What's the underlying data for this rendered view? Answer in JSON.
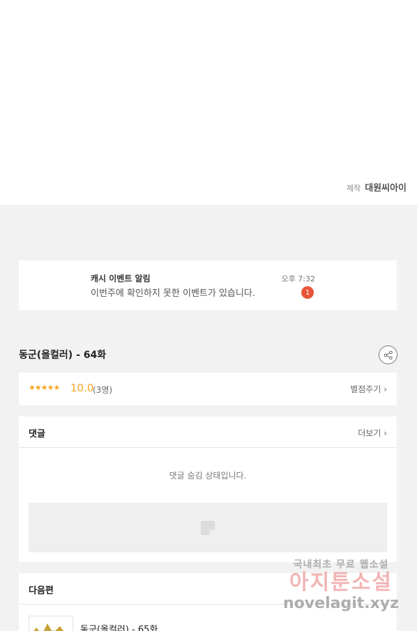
{
  "credit": {
    "label": "제작",
    "name": "대원씨아이"
  },
  "notice": {
    "title": "캐시 이벤트 알림",
    "message": "이번주에 확인하지 못한 이벤트가 있습니다.",
    "time": "오후 7:32",
    "badge": "1"
  },
  "episode": {
    "title": "동군(올컬러) - 64화"
  },
  "rating": {
    "stars": "★★★★★",
    "score": "10.0",
    "count": "(3명)",
    "link": "별점주기 ›"
  },
  "comments": {
    "title": "댓글",
    "more": "더보기 ›",
    "hidden_message": "댓글 숨김 상태입니다."
  },
  "next": {
    "title": "다음편",
    "episode_title": "동군(올컬러) - 65화"
  },
  "watermark": {
    "line1": "국내최초 무료 웹소설",
    "line2": "아지툰소설",
    "line3": "novelagit.xyz"
  },
  "colors": {
    "accent": "#f5a623",
    "badge": "#e8553a",
    "background": "#f2f2f2"
  }
}
